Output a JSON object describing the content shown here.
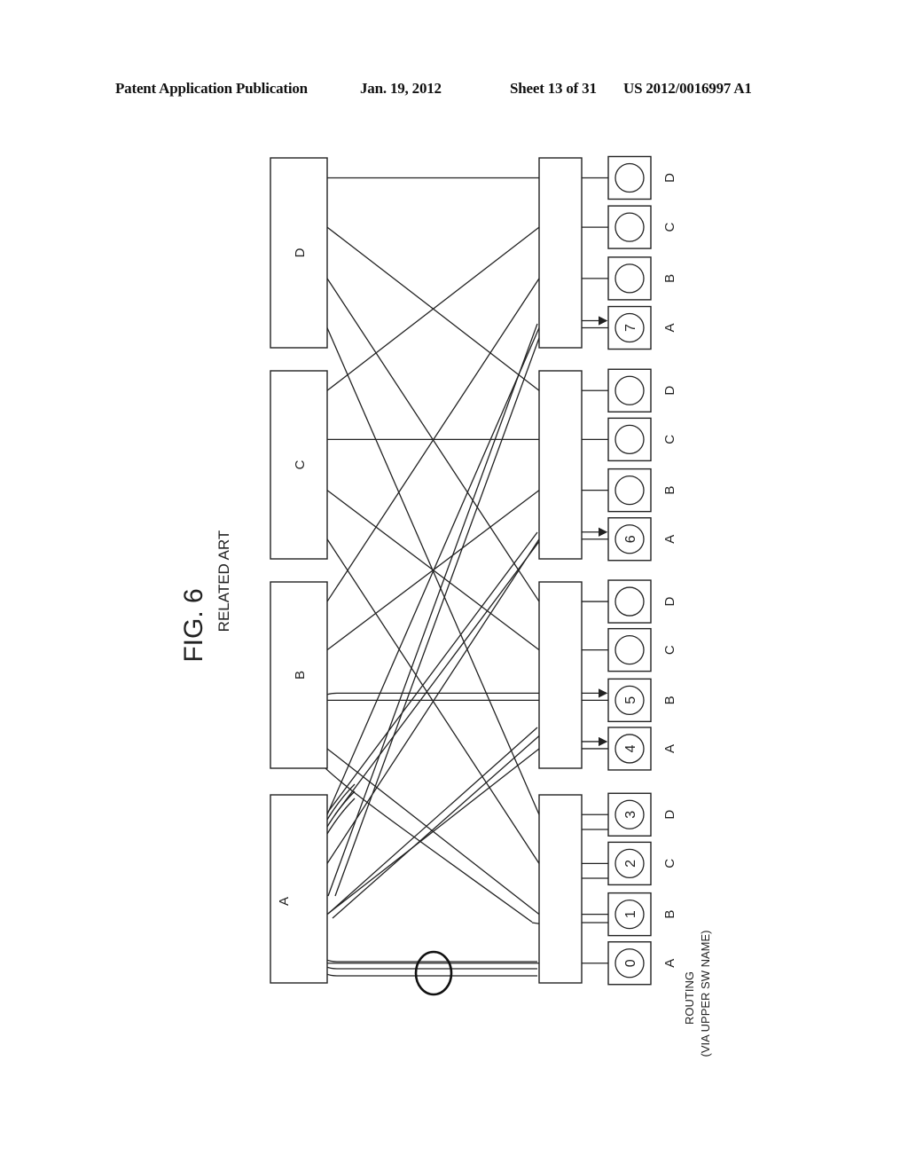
{
  "header": {
    "publication": "Patent Application Publication",
    "date": "Jan. 19, 2012",
    "sheet": "Sheet 13 of 31",
    "number": "US 2012/0016997 A1"
  },
  "figure": {
    "title": "FIG. 6",
    "subtitle": "RELATED ART",
    "upper_switches": [
      {
        "label": "A"
      },
      {
        "label": "B"
      },
      {
        "label": "C"
      },
      {
        "label": "D"
      }
    ],
    "lower_groups": [
      {
        "nodes": [
          {
            "port": "A",
            "id": "0"
          },
          {
            "port": "B",
            "id": "1"
          },
          {
            "port": "C",
            "id": "2"
          },
          {
            "port": "D",
            "id": "3"
          }
        ]
      },
      {
        "nodes": [
          {
            "port": "A",
            "id": "4"
          },
          {
            "port": "B",
            "id": "5"
          },
          {
            "port": "C",
            "id": ""
          },
          {
            "port": "D",
            "id": ""
          }
        ]
      },
      {
        "nodes": [
          {
            "port": "A",
            "id": "6"
          },
          {
            "port": "B",
            "id": ""
          },
          {
            "port": "C",
            "id": ""
          },
          {
            "port": "D",
            "id": ""
          }
        ]
      },
      {
        "nodes": [
          {
            "port": "A",
            "id": "7"
          },
          {
            "port": "B",
            "id": ""
          },
          {
            "port": "C",
            "id": ""
          },
          {
            "port": "D",
            "id": ""
          }
        ]
      }
    ],
    "routing_caption": [
      "ROUTING",
      "(VIA UPPER SW NAME)"
    ]
  }
}
